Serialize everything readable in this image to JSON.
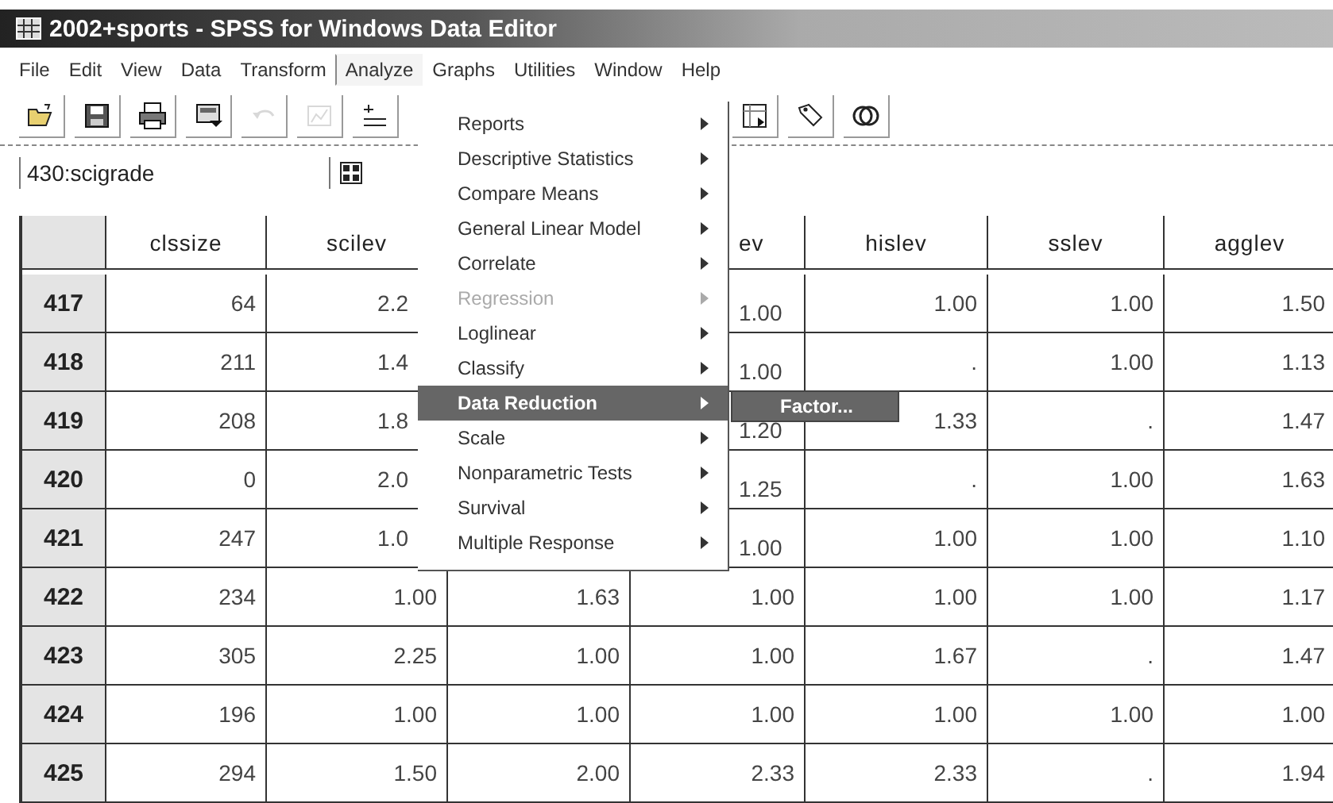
{
  "window": {
    "title": "2002+sports - SPSS for Windows Data Editor"
  },
  "menubar": [
    {
      "label": "File",
      "selected": false
    },
    {
      "label": "Edit",
      "selected": false
    },
    {
      "label": "View",
      "selected": false
    },
    {
      "label": "Data",
      "selected": false
    },
    {
      "label": "Transform",
      "selected": false
    },
    {
      "label": "Analyze",
      "selected": true
    },
    {
      "label": "Graphs",
      "selected": false
    },
    {
      "label": "Utilities",
      "selected": false
    },
    {
      "label": "Window",
      "selected": false
    },
    {
      "label": "Help",
      "selected": false
    }
  ],
  "toolbar": [
    {
      "kind": "open",
      "disabled": false
    },
    {
      "kind": "save",
      "disabled": false
    },
    {
      "kind": "print",
      "disabled": false
    },
    {
      "kind": "dialog",
      "disabled": false
    },
    {
      "kind": "undo",
      "disabled": true
    },
    {
      "kind": "chart",
      "disabled": true
    },
    {
      "kind": "goto",
      "disabled": false
    },
    {
      "kind": "insert",
      "disabled": false
    },
    {
      "kind": "tag",
      "disabled": false
    },
    {
      "kind": "sets",
      "disabled": false
    }
  ],
  "cell_editor": {
    "value": "430:scigrade"
  },
  "table": {
    "columns": [
      "clssize",
      "scilev",
      null,
      "ev",
      "hislev",
      "sslev",
      "agglev"
    ],
    "rows": [
      {
        "case": "417",
        "under_menu": true,
        "cells": [
          "64",
          "2.2",
          null,
          "1.00",
          "1.00",
          "1.00",
          "1.50"
        ]
      },
      {
        "case": "418",
        "under_menu": true,
        "cells": [
          "211",
          "1.4",
          null,
          "1.00",
          ".",
          "1.00",
          "1.13"
        ]
      },
      {
        "case": "419",
        "under_menu": true,
        "cells": [
          "208",
          "1.8",
          null,
          "1.20",
          "1.33",
          ".",
          "1.47"
        ]
      },
      {
        "case": "420",
        "under_menu": true,
        "cells": [
          "0",
          "2.0",
          null,
          "1.25",
          ".",
          "1.00",
          "1.63"
        ]
      },
      {
        "case": "421",
        "under_menu": true,
        "cells": [
          "247",
          "1.0",
          null,
          "1.00",
          "1.00",
          "1.00",
          "1.10"
        ]
      },
      {
        "case": "422",
        "under_menu": false,
        "cells": [
          "234",
          "1.00",
          "1.63",
          "1.00",
          "1.00",
          "1.00",
          "1.17"
        ]
      },
      {
        "case": "423",
        "under_menu": false,
        "cells": [
          "305",
          "2.25",
          "1.00",
          "1.00",
          "1.67",
          ".",
          "1.47"
        ]
      },
      {
        "case": "424",
        "under_menu": false,
        "cells": [
          "196",
          "1.00",
          "1.00",
          "1.00",
          "1.00",
          "1.00",
          "1.00"
        ]
      },
      {
        "case": "425",
        "under_menu": false,
        "cells": [
          "294",
          "1.50",
          "2.00",
          "2.33",
          "2.33",
          ".",
          "1.94"
        ]
      }
    ]
  },
  "analyze_menu": {
    "items": [
      {
        "label": "Reports",
        "selected": false,
        "disabled": false
      },
      {
        "label": "Descriptive Statistics",
        "selected": false,
        "disabled": false
      },
      {
        "label": "Compare Means",
        "selected": false,
        "disabled": false
      },
      {
        "label": "General Linear Model",
        "selected": false,
        "disabled": false
      },
      {
        "label": "Correlate",
        "selected": false,
        "disabled": false
      },
      {
        "label": "Regression",
        "selected": false,
        "disabled": true
      },
      {
        "label": "Loglinear",
        "selected": false,
        "disabled": false
      },
      {
        "label": "Classify",
        "selected": false,
        "disabled": false
      },
      {
        "label": "Data Reduction",
        "selected": true,
        "disabled": false
      },
      {
        "label": "Scale",
        "selected": false,
        "disabled": false
      },
      {
        "label": "Nonparametric Tests",
        "selected": false,
        "disabled": false
      },
      {
        "label": "Survival",
        "selected": false,
        "disabled": false
      },
      {
        "label": "Multiple Response",
        "selected": false,
        "disabled": false
      }
    ],
    "submenu": [
      {
        "label": "Factor...",
        "selected": true
      }
    ]
  }
}
